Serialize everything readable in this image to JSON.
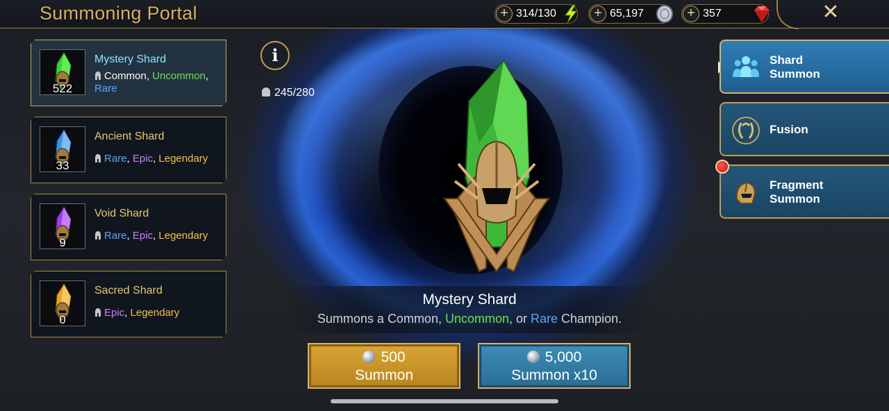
{
  "header": {
    "title": "Summoning Portal",
    "resources": [
      {
        "value": "314/130",
        "icon": "energy-bolt-icon"
      },
      {
        "value": "65,197",
        "icon": "silver-coin-icon"
      },
      {
        "value": "357",
        "icon": "ruby-gem-icon"
      }
    ],
    "close_icon": "close-icon"
  },
  "shards": [
    {
      "name": "Mystery Shard",
      "count": "522",
      "selected": true,
      "rarities": [
        {
          "label": "Common",
          "sep": ", "
        },
        {
          "label": "Uncommon",
          "sep": ","
        },
        {
          "label": "Rare",
          "sep": ""
        }
      ]
    },
    {
      "name": "Ancient Shard",
      "count": "33",
      "rarities": [
        {
          "label": "Rare",
          "sep": ", "
        },
        {
          "label": "Epic",
          "sep": ", "
        },
        {
          "label": "Legendary",
          "sep": ""
        }
      ]
    },
    {
      "name": "Void Shard",
      "count": "9",
      "rarities": [
        {
          "label": "Rare",
          "sep": ", "
        },
        {
          "label": "Epic",
          "sep": ", "
        },
        {
          "label": "Legendary",
          "sep": ""
        }
      ]
    },
    {
      "name": "Sacred Shard",
      "count": "0",
      "rarities": [
        {
          "label": "Epic",
          "sep": ", "
        },
        {
          "label": "Legendary",
          "sep": ""
        }
      ]
    }
  ],
  "info_glyph": "i",
  "champion_capacity": "245/280",
  "detail": {
    "title": "Mystery Shard",
    "desc_before": "Summons a ",
    "desc_common": "Common",
    "desc_sep1": ", ",
    "desc_uncommon": "Uncommon",
    "desc_sep2": ", or ",
    "desc_rare": "Rare",
    "desc_after": " Champion."
  },
  "buttons": {
    "summon": {
      "cost": "500",
      "label": "Summon"
    },
    "summon10": {
      "cost": "5,000",
      "label": "Summon x10"
    }
  },
  "menu": {
    "shard_summon": {
      "line1": "Shard",
      "line2": "Summon",
      "active": true
    },
    "fusion": {
      "line1": "Fusion"
    },
    "fragment_summon": {
      "line1": "Fragment",
      "line2": "Summon"
    }
  },
  "colors": {
    "gold": "#d9b25e",
    "uncommon": "#6ee04c",
    "rare": "#5aa7ff",
    "epic": "#d27bff",
    "legendary": "#f2c24a",
    "portal_blue": "#2a63d0"
  }
}
